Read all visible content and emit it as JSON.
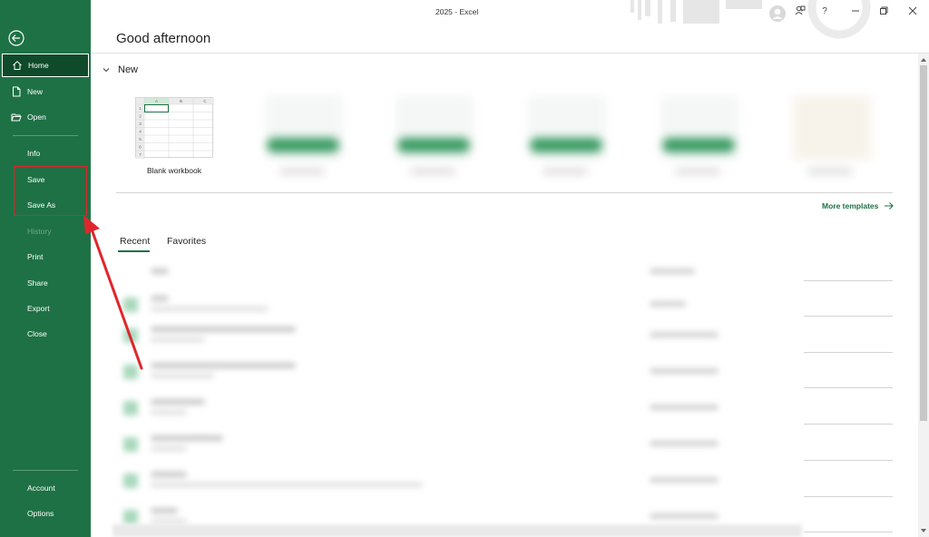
{
  "window": {
    "title": "2025  -  Excel"
  },
  "sidebar": {
    "items": [
      {
        "label": "Home"
      },
      {
        "label": "New"
      },
      {
        "label": "Open"
      },
      {
        "label": "Info"
      },
      {
        "label": "Save"
      },
      {
        "label": "Save As"
      },
      {
        "label": "History"
      },
      {
        "label": "Print"
      },
      {
        "label": "Share"
      },
      {
        "label": "Export"
      },
      {
        "label": "Close"
      }
    ],
    "footer": [
      {
        "label": "Account"
      },
      {
        "label": "Options"
      }
    ]
  },
  "main": {
    "greeting": "Good afternoon",
    "new_section": {
      "heading": "New",
      "blank_workbook_label": "Blank workbook",
      "grid_columns": [
        "A",
        "B",
        "C"
      ],
      "grid_rows": [
        "1",
        "2",
        "3",
        "4",
        "5",
        "6",
        "7"
      ],
      "more_templates": "More templates"
    },
    "tabs": [
      {
        "label": "Recent"
      },
      {
        "label": "Favorites"
      }
    ]
  },
  "colors": {
    "sidebar": "#1e7145",
    "sidebar_active": "#0f4a2a",
    "accent": "#1e7145",
    "annotation": "#d9262b"
  },
  "icons": {
    "back": "back-arrow-icon",
    "home": "home-icon",
    "new": "new-file-icon",
    "open": "folder-open-icon"
  }
}
